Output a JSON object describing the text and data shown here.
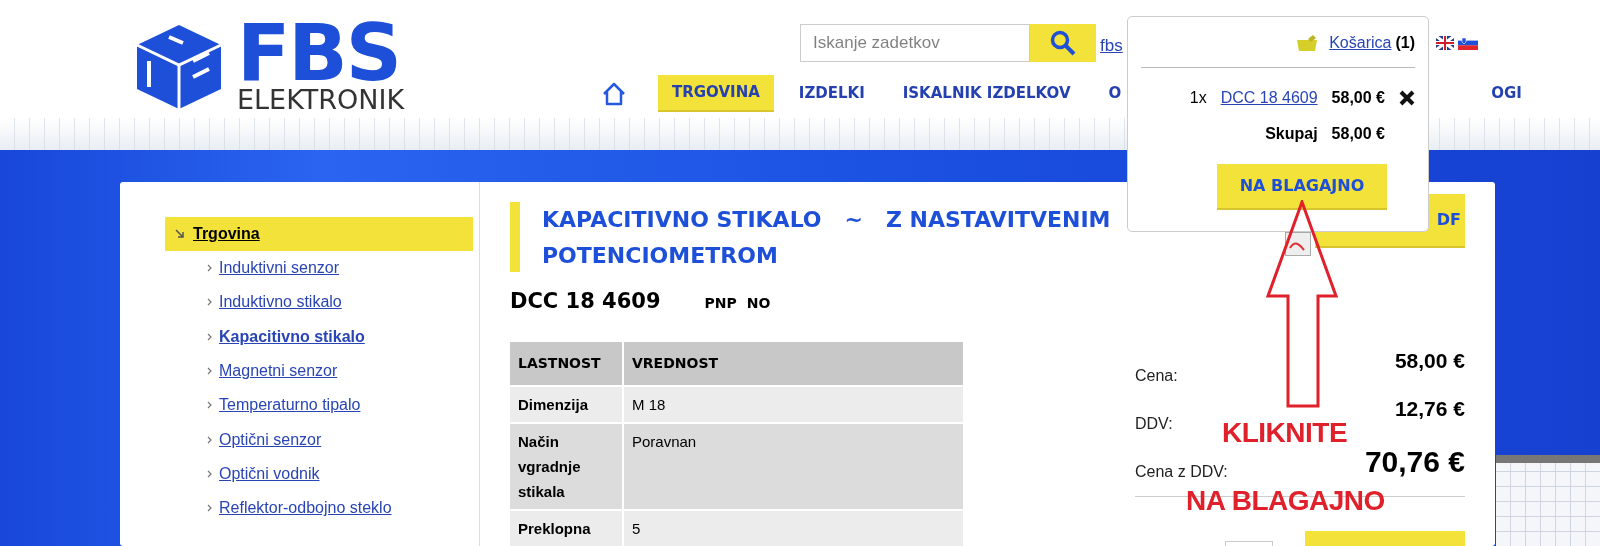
{
  "header": {
    "logo": {
      "brand": "FBS",
      "subtitle": "ELEKTRONIK"
    },
    "search": {
      "placeholder": "Iskanje zadetkov"
    },
    "top_link": "fbs",
    "nav": [
      {
        "kind": "home",
        "selected": false
      },
      {
        "kind": "text",
        "label": "TRGOVINA",
        "selected": true
      },
      {
        "kind": "text",
        "label": "IZDELKI",
        "selected": false
      },
      {
        "kind": "text",
        "label": "ISKALNIK IZDELKOV",
        "selected": false
      },
      {
        "kind": "text",
        "label": "O",
        "selected": false
      },
      {
        "kind": "text",
        "label": "OGI",
        "selected": false
      }
    ]
  },
  "sidebar": {
    "title": "Trgovina",
    "items": [
      {
        "label": "Induktivni senzor",
        "selected": false
      },
      {
        "label": "Induktivno stikalo",
        "selected": false
      },
      {
        "label": "Kapacitivno stikalo",
        "selected": true
      },
      {
        "label": "Magnetni senzor",
        "selected": false
      },
      {
        "label": "Temperaturno tipalo",
        "selected": false
      },
      {
        "label": "Optični senzor",
        "selected": false
      },
      {
        "label": "Optični vodnik",
        "selected": false
      },
      {
        "label": "Reflektor-odbojno steklo",
        "selected": false
      }
    ]
  },
  "product": {
    "title_lines": [
      "KAPACITIVNO STIKALO   ~   Z NASTAVITVENIM",
      "POTENCIOMETROM"
    ],
    "code": "DCC 18 4609",
    "tags": [
      "PNP",
      "NO"
    ],
    "pdf_button": "DF",
    "table": {
      "columns": [
        "LASTNOST",
        "VREDNOST"
      ],
      "rows": [
        [
          "Dimenzija",
          "M 18"
        ],
        [
          "Način vgradnje stikala",
          "Poravnan"
        ],
        [
          "Preklopna",
          "5"
        ]
      ]
    },
    "prices": [
      {
        "label": "Cena:",
        "value": "58,00 €",
        "kind": "normal"
      },
      {
        "label": "DDV:",
        "value": "12,76 €",
        "kind": "normal"
      },
      {
        "label": "Cena z DDV:",
        "value": "70,76 €",
        "kind": "total"
      }
    ]
  },
  "cart_popup": {
    "link": "Košarica",
    "count": "(1)",
    "items": [
      {
        "qty": "1x",
        "name": "DCC 18 4609",
        "price": "58,00 €"
      }
    ],
    "total_label": "Skupaj",
    "total": "58,00 €",
    "checkout": "NA BLAGAJNO"
  },
  "annotation": {
    "lines": [
      "KLIKNITE",
      "NA BLAGAJNO"
    ]
  }
}
